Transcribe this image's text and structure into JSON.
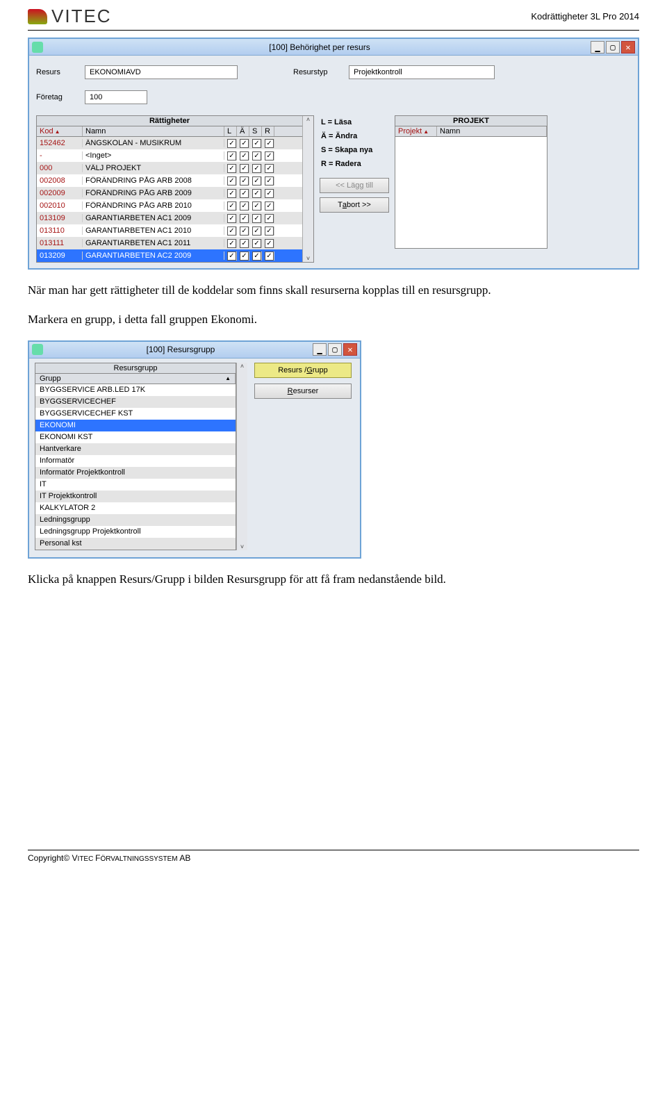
{
  "header": {
    "logo_text": "VITEC",
    "doc_title": "Kodrättigheter 3L Pro 2014"
  },
  "window1": {
    "title": "[100]   Behörighet per resurs",
    "fields": {
      "resurs_label": "Resurs",
      "resurs_value": "EKONOMIAVD",
      "resurstyp_label": "Resurstyp",
      "resurstyp_value": "Projektkontroll",
      "foretag_label": "Företag",
      "foretag_value": "100"
    },
    "rights_panel": {
      "title": "Rättigheter",
      "headers": {
        "kod": "Kod",
        "namn": "Namn",
        "l": "L",
        "a": "Ä",
        "s": "S",
        "r": "R"
      },
      "rows": [
        {
          "kod": "152462",
          "namn": "ÄNGSKOLAN - MUSIKRUM",
          "l": true,
          "a": true,
          "s": true,
          "r": true,
          "sel": false
        },
        {
          "kod": "-",
          "namn": "<Inget>",
          "l": true,
          "a": true,
          "s": true,
          "r": true,
          "sel": false
        },
        {
          "kod": "000",
          "namn": "VÄLJ PROJEKT",
          "l": true,
          "a": true,
          "s": true,
          "r": true,
          "sel": false
        },
        {
          "kod": "002008",
          "namn": "FÖRÄNDRING PÅG ARB 2008",
          "l": true,
          "a": true,
          "s": true,
          "r": true,
          "sel": false
        },
        {
          "kod": "002009",
          "namn": "FÖRÄNDRING PÅG ARB 2009",
          "l": true,
          "a": true,
          "s": true,
          "r": true,
          "sel": false
        },
        {
          "kod": "002010",
          "namn": "FÖRÄNDRING PÅG ARB 2010",
          "l": true,
          "a": true,
          "s": true,
          "r": true,
          "sel": false
        },
        {
          "kod": "013109",
          "namn": "GARANTIARBETEN AC1 2009",
          "l": true,
          "a": true,
          "s": true,
          "r": true,
          "sel": false
        },
        {
          "kod": "013110",
          "namn": "GARANTIARBETEN AC1 2010",
          "l": true,
          "a": true,
          "s": true,
          "r": true,
          "sel": false
        },
        {
          "kod": "013111",
          "namn": "GARANTIARBETEN AC1 2011",
          "l": true,
          "a": true,
          "s": true,
          "r": true,
          "sel": false
        },
        {
          "kod": "013209",
          "namn": "GARANTIARBETEN AC2 2009",
          "l": true,
          "a": true,
          "s": true,
          "r": true,
          "sel": true
        }
      ]
    },
    "legend": {
      "l": "L = Läsa",
      "a": "Ä = Ändra",
      "s": "S = Skapa nya",
      "r": "R = Radera"
    },
    "mid_buttons": {
      "add": "<<   Lägg till",
      "remove_pre": "T",
      "remove_u": "a",
      "remove_post": " bort   >>"
    },
    "projekt_panel": {
      "title": "PROJEKT",
      "headers": {
        "projekt": "Projekt",
        "namn": "Namn"
      }
    }
  },
  "prose1": "När man har gett rättigheter till de koddelar som finns skall resurserna kopplas till en resursgrupp.",
  "prose2": "Markera en grupp, i detta fall gruppen Ekonomi.",
  "window2": {
    "title": "[100]  Resursgrupp",
    "list_title": "Resursgrupp",
    "header": "Grupp",
    "items": [
      {
        "t": "BYGGSERVICE ARB.LED 17K",
        "sel": false
      },
      {
        "t": "BYGGSERVICECHEF",
        "sel": false
      },
      {
        "t": "BYGGSERVICECHEF KST",
        "sel": false
      },
      {
        "t": "EKONOMI",
        "sel": true
      },
      {
        "t": "EKONOMI KST",
        "sel": false
      },
      {
        "t": "Hantverkare",
        "sel": false
      },
      {
        "t": "Informatör",
        "sel": false
      },
      {
        "t": "Informatör Projektkontroll",
        "sel": false
      },
      {
        "t": "IT",
        "sel": false
      },
      {
        "t": "IT Projektkontroll",
        "sel": false
      },
      {
        "t": "KALKYLATOR 2",
        "sel": false
      },
      {
        "t": "Ledningsgrupp",
        "sel": false
      },
      {
        "t": "Ledningsgrupp Projektkontroll",
        "sel": false
      },
      {
        "t": "Personal kst",
        "sel": false
      }
    ],
    "btn_resurs_grupp_pre": "Resurs / ",
    "btn_resurs_grupp_u": "G",
    "btn_resurs_grupp_post": "rupp",
    "btn_resurser_u": "R",
    "btn_resurser_post": "esurser"
  },
  "prose3": "Klicka på knappen Resurs/Grupp i bilden Resursgrupp för att få fram nedanstående bild.",
  "footer": {
    "copyright_pre": "Copyright© V",
    "copyright_sc": "ITEC ",
    "copyright_post1": "F",
    "copyright_sc2": "ÖRVALTNINGSSYSTEM ",
    "copyright_post2": "AB"
  }
}
